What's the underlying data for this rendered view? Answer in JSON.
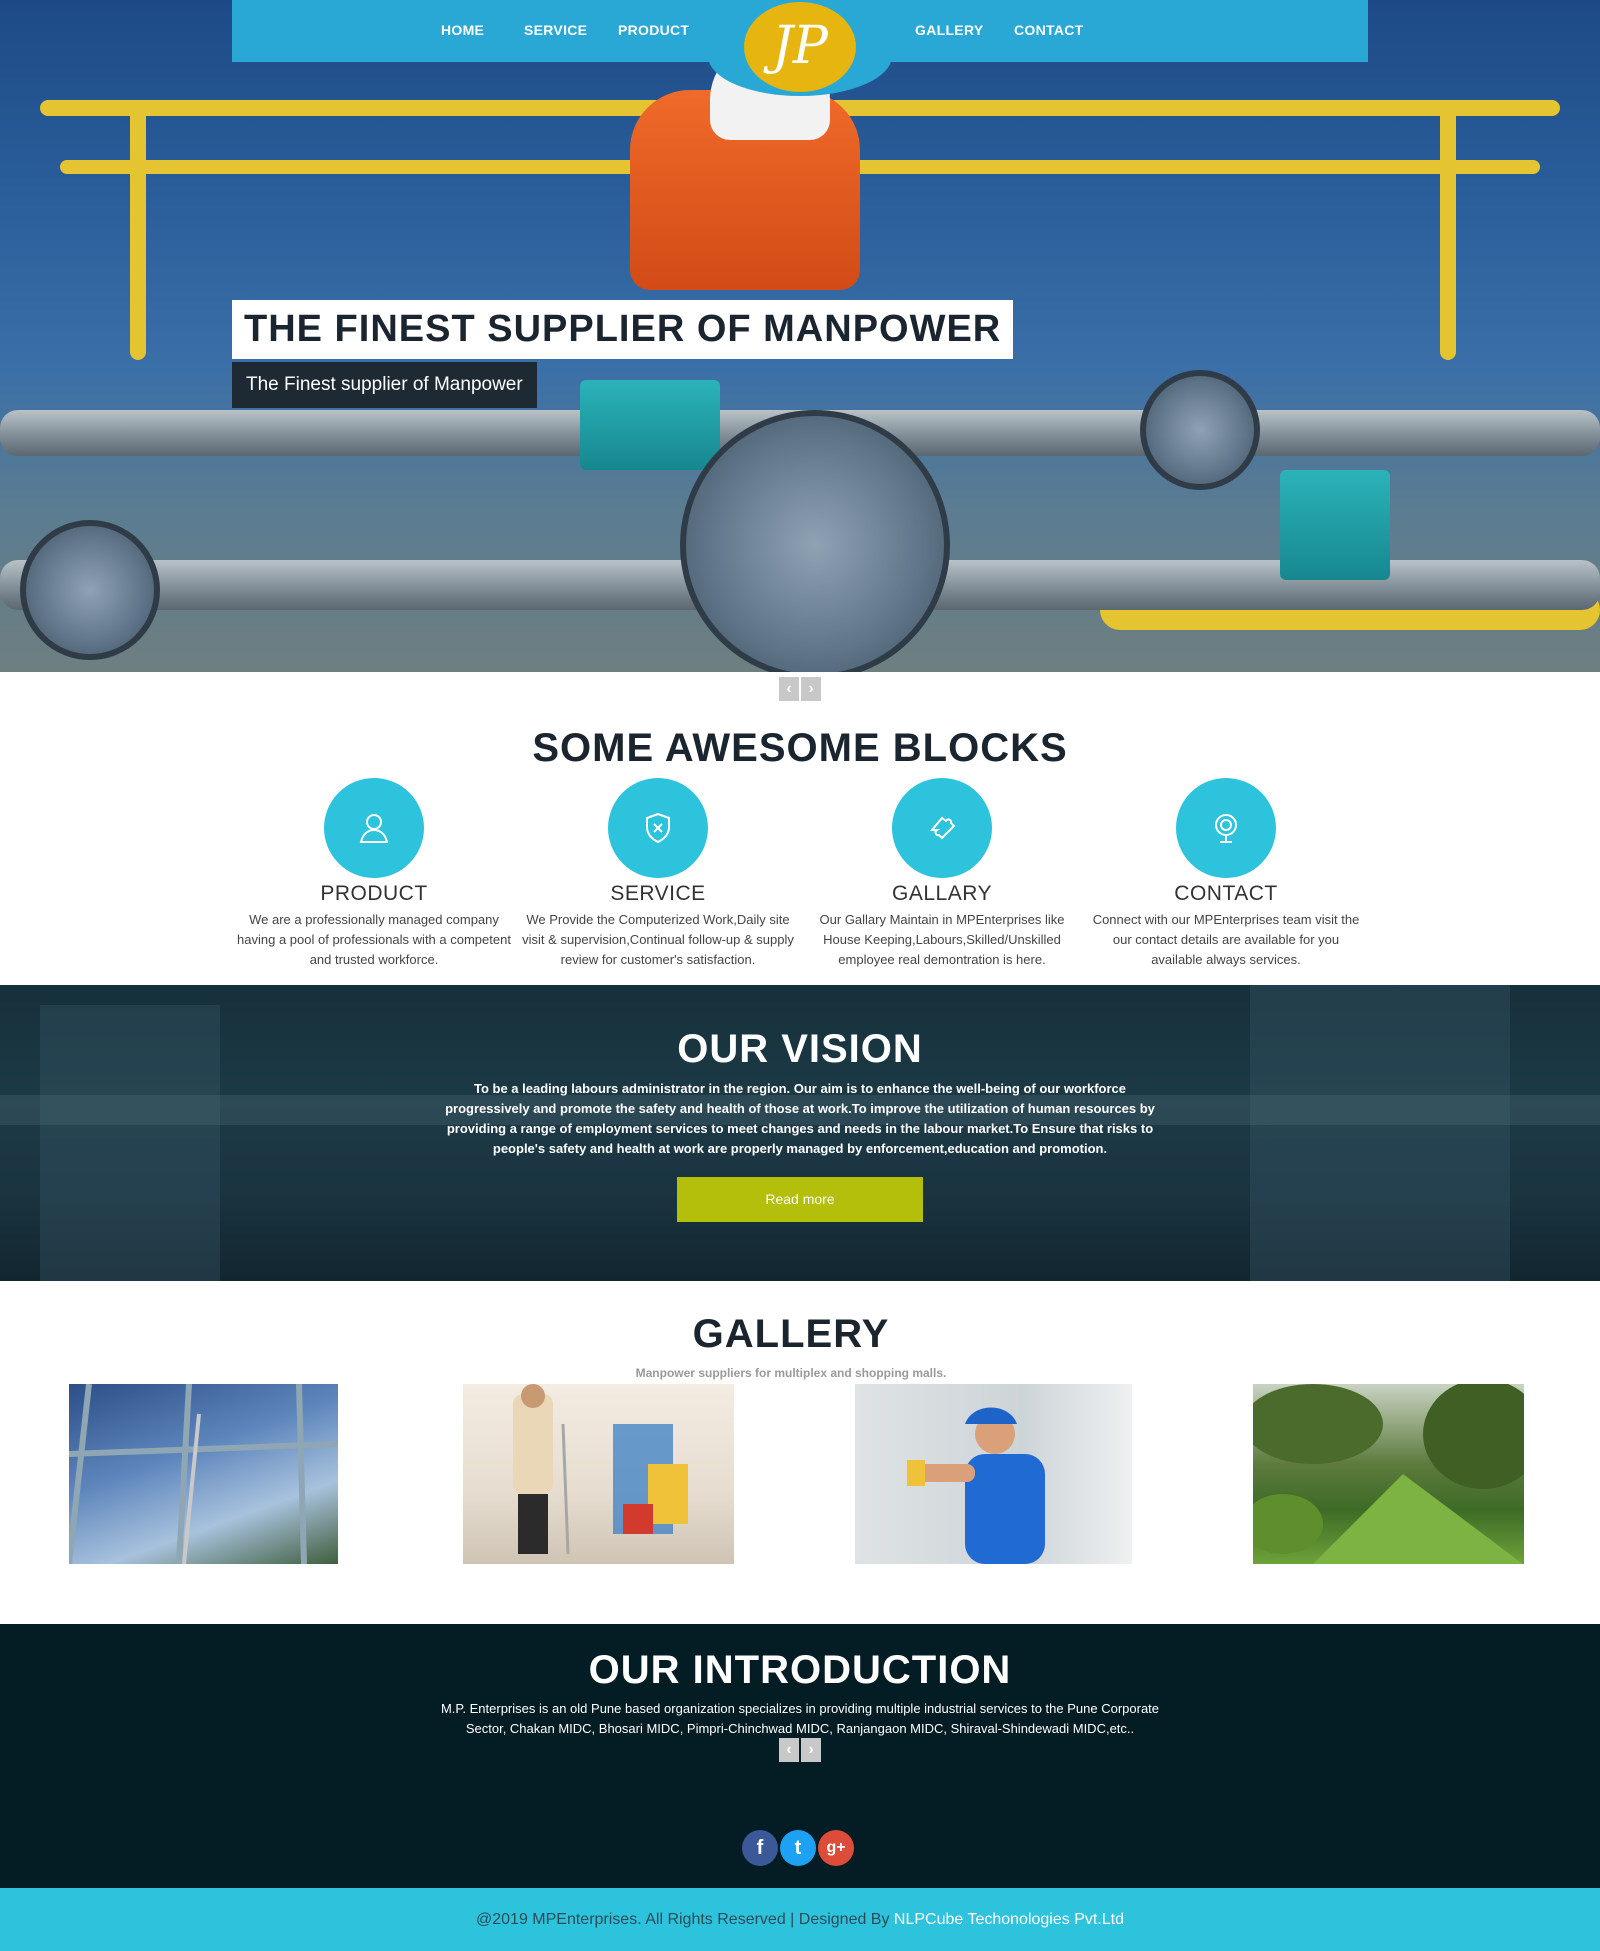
{
  "nav": {
    "items": [
      "HOME",
      "SERVICE",
      "PRODUCT",
      "GALLERY",
      "CONTACT"
    ],
    "logo_text": "JP"
  },
  "hero": {
    "title": "THE FINEST SUPPLIER OF MANPOWER",
    "subtitle": "The Finest supplier of Manpower"
  },
  "blocks": {
    "title": "SOME AWESOME BLOCKS",
    "items": [
      {
        "icon": "user-icon",
        "title": "PRODUCT",
        "text": "We are a professionally managed company having a pool of professionals with a competent and trusted workforce."
      },
      {
        "icon": "shield-icon",
        "title": "SERVICE",
        "text": "We Provide the Computerized Work,Daily site visit & supervision,Continual follow-up & supply review for customer's satisfaction."
      },
      {
        "icon": "puzzle-icon",
        "title": "GALLARY",
        "text": "Our Gallary Maintain in MPEnterprises like House Keeping,Labours,Skilled/Unskilled employee real demontration is here."
      },
      {
        "icon": "globe-icon",
        "title": "CONTACT",
        "text": "Connect with our MPEnterprises team visit the our contact details are available for you available always services."
      }
    ]
  },
  "vision": {
    "title": "OUR VISION",
    "text": "To be a leading labours administrator in the region. Our aim is to enhance the well-being of our workforce progressively and promote the safety and health of those at work.To improve the utilization of human resources by providing a range of employment services to meet changes and needs in the labour market.To Ensure that risks to people's safety and health at work are properly managed by enforcement,education and promotion.",
    "button": "Read more"
  },
  "gallery": {
    "title": "GALLERY",
    "subtitle": "Manpower suppliers for multiplex and shopping malls."
  },
  "intro": {
    "title": "OUR INTRODUCTION",
    "text": "M.P. Enterprises is an old Pune based organization specializes in providing multiple industrial services to the Pune Corporate Sector, Chakan MIDC, Bhosari MIDC, Pimpri-Chinchwad MIDC, Ranjangaon MIDC, Shiraval-Shindewadi MIDC,etc.."
  },
  "social": {
    "facebook": "f",
    "twitter": "t",
    "google": "g+"
  },
  "slider": {
    "prev": "‹",
    "next": "›"
  },
  "footer": {
    "text": "@2019 MPEnterprises. All Rights Reserved | Designed By ",
    "link": "NLPCube Techonologies Pvt.Ltd"
  },
  "colors": {
    "nav_bg": "#29a8d6",
    "accent_cyan": "#2dc3dd",
    "button_green": "#b3bf0a",
    "logo_yellow": "#e7b510",
    "intro_bg": "#041c23"
  }
}
